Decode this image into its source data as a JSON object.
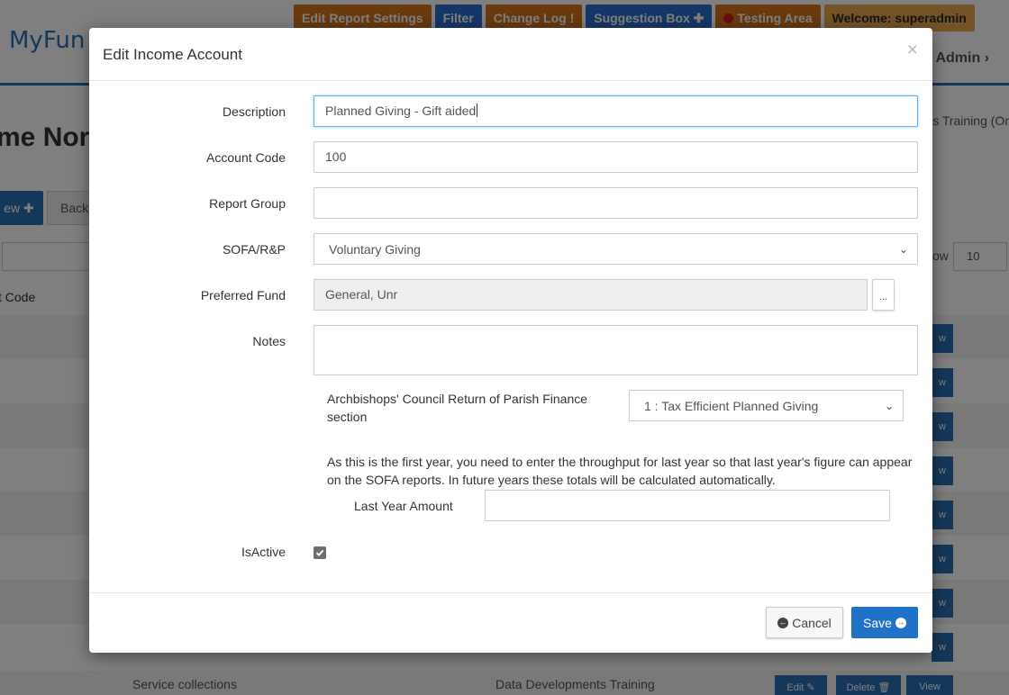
{
  "background": {
    "logo_text": "MyFun",
    "topbar": {
      "edit_report_settings": "Edit Report Settings",
      "filter": "Filter",
      "change_log": "Change Log !",
      "suggestion_box": "Suggestion Box ✚",
      "testing_area": "Testing Area",
      "welcome": "Welcome:  superadmin"
    },
    "admin_link": "Admin ›",
    "page_heading": "me Nor",
    "training_text": "s Training (Or",
    "new_button": "ew ✚",
    "back_button": "Back",
    "show_label": "ow",
    "show_value": "10",
    "column_header": "t Code",
    "row_view_label": "w",
    "last_row": {
      "description": "Service collections",
      "fund": "Data Developments Training",
      "edit": "Edit ✎",
      "delete": "Delete 🗑",
      "view": "View"
    }
  },
  "modal": {
    "title": "Edit Income Account",
    "close_symbol": "×",
    "fields": {
      "description": {
        "label": "Description",
        "value": "Planned Giving - Gift aided"
      },
      "account_code": {
        "label": "Account Code",
        "value": "100"
      },
      "report_group": {
        "label": "Report Group",
        "value": ""
      },
      "sofa": {
        "label": "SOFA/R&P",
        "value": "Voluntary Giving"
      },
      "preferred_fund": {
        "label": "Preferred Fund",
        "value": "General, Unr",
        "picker_label": "..."
      },
      "notes": {
        "label": "Notes",
        "value": ""
      },
      "archbishops": {
        "label": "Archbishops' Council Return of Parish Finance section",
        "value": "1 : Tax Efficient Planned Giving"
      },
      "first_year_note": "As this is the first year, you need to enter the throughput for last year so that last year's figure can appear on the SOFA reports. In future years these totals will be calculated automatically.",
      "last_year_amount": {
        "label": "Last Year Amount",
        "value": ""
      },
      "is_active": {
        "label": "IsActive",
        "checked": true
      }
    },
    "buttons": {
      "cancel": "Cancel",
      "save": "Save"
    }
  }
}
